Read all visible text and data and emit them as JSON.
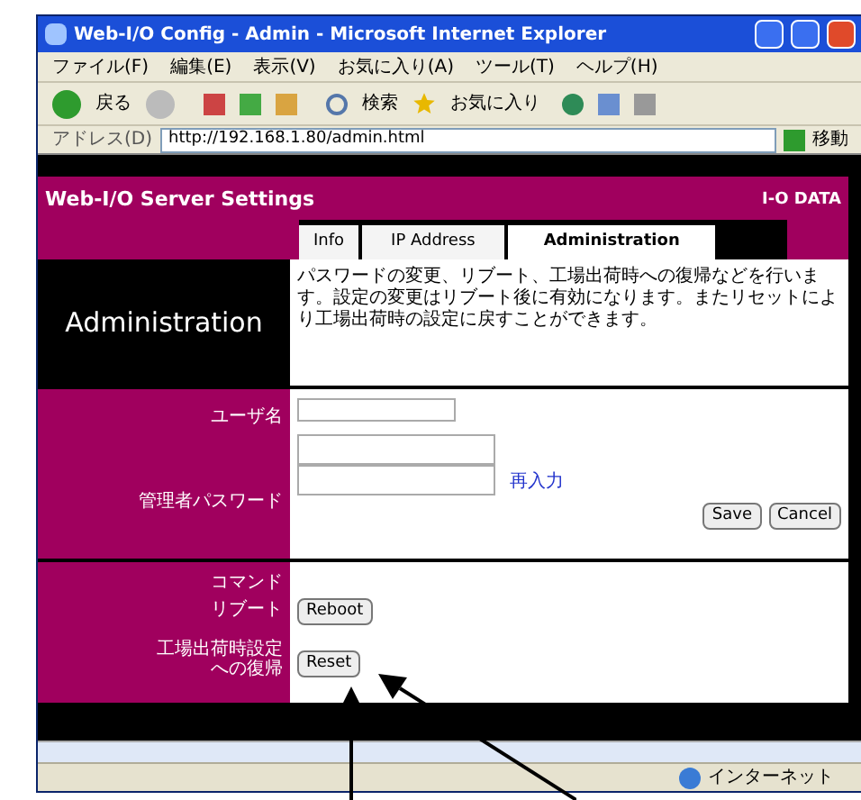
{
  "window": {
    "title": "Web-I/O Config - Admin - Microsoft Internet Explorer"
  },
  "menu_bar": [
    "ファイル(F)",
    "編集(E)",
    "表示(V)",
    "お気に入り(A)",
    "ツール(T)",
    "ヘルプ(H)"
  ],
  "toolbar": {
    "back": "戻る",
    "search": "検索",
    "favorites": "お気に入り"
  },
  "address_bar": {
    "label": "アドレス(D)",
    "url": "http://192.168.1.80/admin.html",
    "go": "移動"
  },
  "page": {
    "header": {
      "title": "Web-I/O Server Settings",
      "right_label": "I-O DATA"
    },
    "tabs": [
      {
        "label": "Info",
        "selected": false
      },
      {
        "label": "IP Address",
        "selected": false
      },
      {
        "label": "Administration",
        "selected": true
      }
    ],
    "section_title": "Administration",
    "description": "パスワードの変更、リブート、工場出荷時への復帰などを行います。設定の変更はリブート後に有効になります。またリセットにより工場出荷時の設定に戻すことができます。",
    "user_label": "ユーザ名",
    "password_label": "管理者パスワード",
    "confirm_label": "再入力",
    "buttons": [
      "Save",
      "Cancel"
    ],
    "command_label": "コマンド",
    "commands": [
      {
        "label": "リブート",
        "button": "Reboot"
      },
      {
        "label": "工場出荷時設定への復帰",
        "button": "Reset"
      }
    ]
  },
  "status_bar": {
    "zone": "インターネット"
  }
}
